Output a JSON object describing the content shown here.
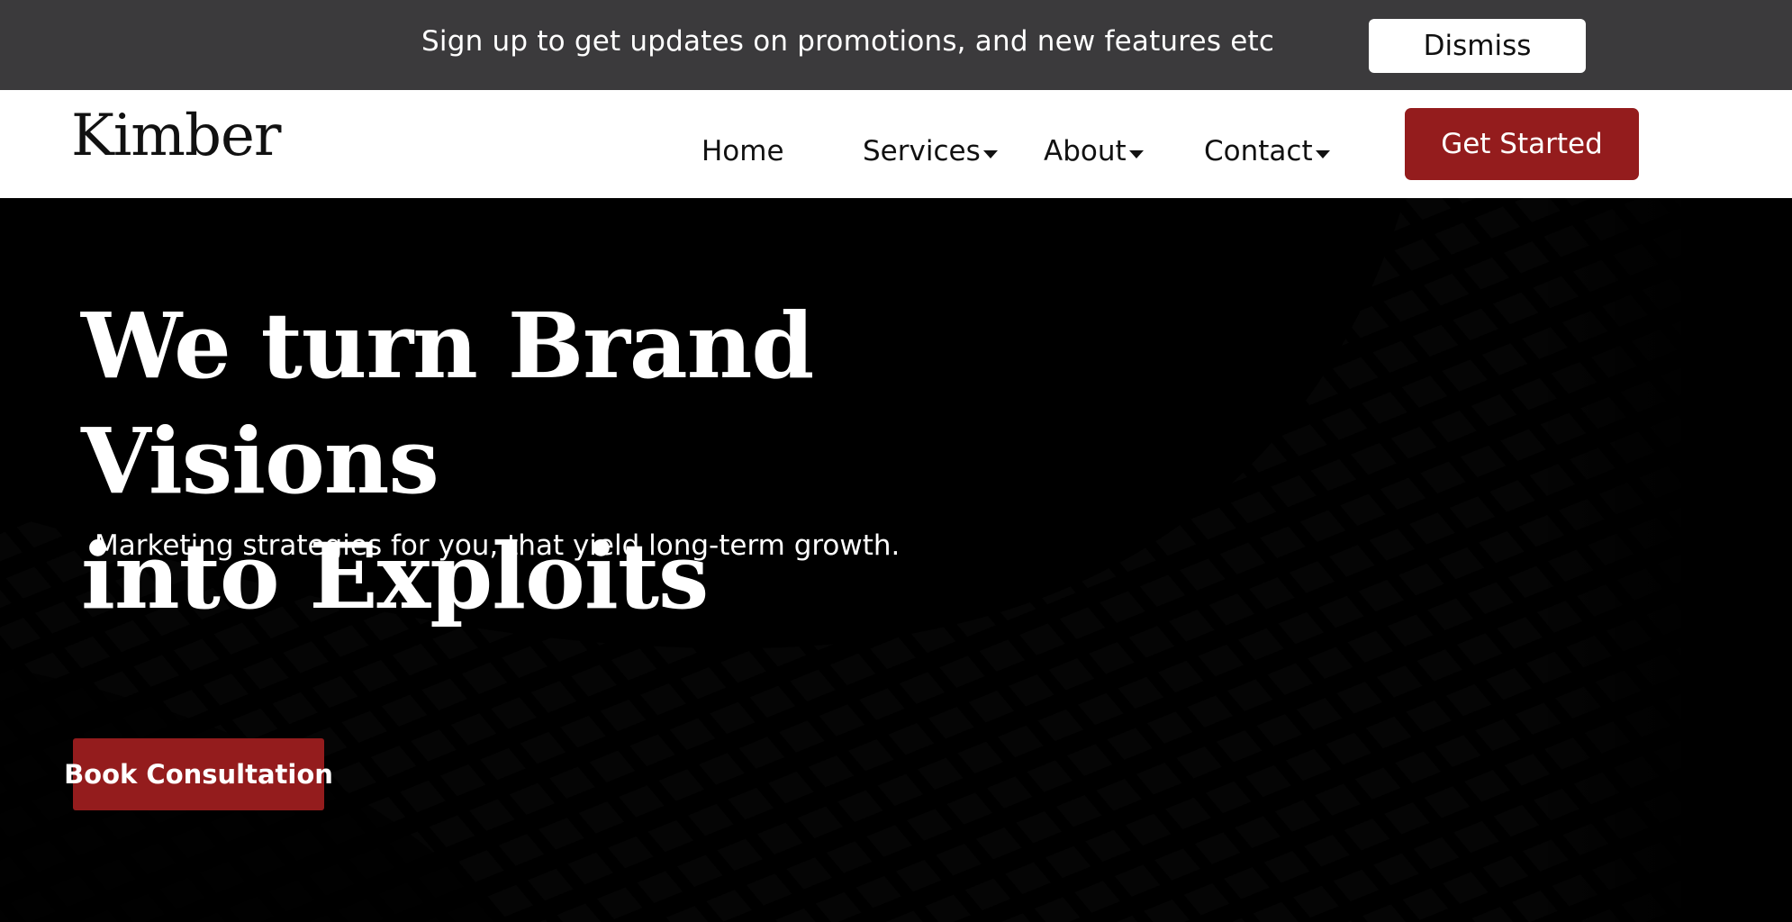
{
  "promo": {
    "text": "Sign up to get updates on promotions, and new features etc",
    "dismiss_label": "Dismiss"
  },
  "header": {
    "logo": "Kimber",
    "nav": [
      {
        "label": "Home",
        "has_dropdown": false
      },
      {
        "label": "Services",
        "has_dropdown": true
      },
      {
        "label": "About",
        "has_dropdown": true
      },
      {
        "label": "Contact",
        "has_dropdown": true
      }
    ],
    "cta_label": "Get Started"
  },
  "hero": {
    "title_line1": "We turn Brand Visions",
    "title_line2": "into Exploits",
    "subtitle": "Marketing strategies for you, that yield long-term growth.",
    "cta_label": "Book Consultation"
  },
  "colors": {
    "promo_bg": "#3b3a3c",
    "accent": "#941c1d",
    "hero_bg": "#000000"
  },
  "icons": {
    "dropdown": "caret-down-icon"
  }
}
